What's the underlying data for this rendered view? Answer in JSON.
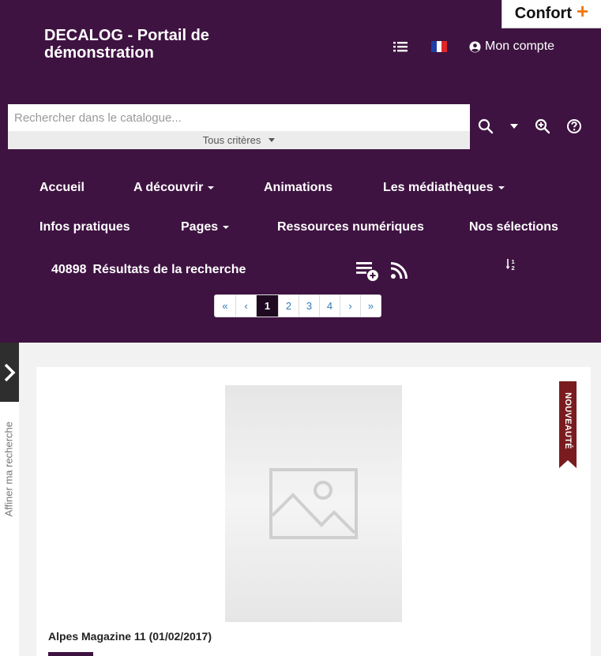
{
  "confort": {
    "label": "Confort",
    "plus": "+"
  },
  "site": {
    "title": "DECALOG - Portail de démonstration"
  },
  "top_bar": {
    "list_icon": "list-icon",
    "flag_icon": "french-flag-icon",
    "account_label": "Mon compte"
  },
  "search": {
    "placeholder": "Rechercher dans le catalogue...",
    "value": "",
    "criteria_label": "Tous critères"
  },
  "nav": {
    "items": [
      {
        "label": "Accueil",
        "dropdown": false
      },
      {
        "label": "A découvrir",
        "dropdown": true
      },
      {
        "label": "Animations",
        "dropdown": false
      },
      {
        "label": "Les médiathèques",
        "dropdown": true
      },
      {
        "label": "Infos pratiques",
        "dropdown": false
      },
      {
        "label": "Pages",
        "dropdown": true
      },
      {
        "label": "Ressources numériques",
        "dropdown": false
      },
      {
        "label": "Nos sélections",
        "dropdown": false
      }
    ]
  },
  "results": {
    "count": "40898",
    "label": "Résultats de la recherche"
  },
  "pagination": {
    "first": "«",
    "prev": "‹",
    "pages": [
      "1",
      "2",
      "3",
      "4"
    ],
    "current": "1",
    "next": "›",
    "last": "»"
  },
  "refine": {
    "label": "Affiner ma recherche"
  },
  "result_card": {
    "badge": "NOUVEAUTÉ",
    "title": "Alpes Magazine 11 (01/02/2017)"
  },
  "colors": {
    "header_bg": "#3e1341",
    "accent_orange": "#f07a12",
    "badge_bg": "#7a1c1f",
    "active_page": "#1f0a22"
  }
}
